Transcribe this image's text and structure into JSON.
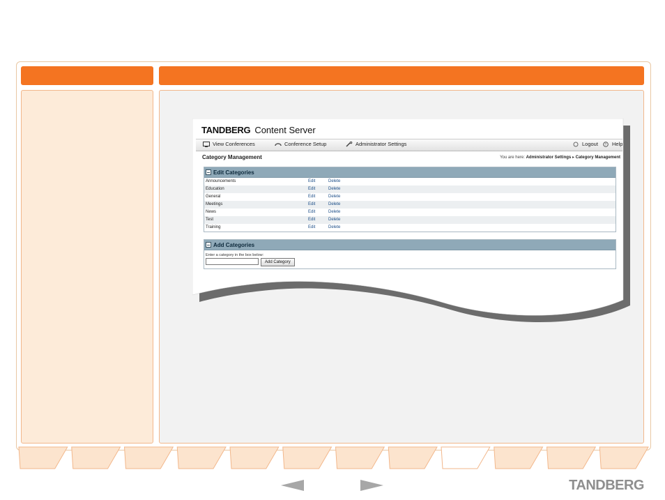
{
  "app": {
    "brand_strong": "TANDBERG",
    "brand_light": "Content Server"
  },
  "nav": {
    "items": [
      {
        "label": "View Conferences",
        "icon": "monitor-icon"
      },
      {
        "label": "Conference Setup",
        "icon": "phone-icon"
      },
      {
        "label": "Administrator Settings",
        "icon": "wrench-icon"
      }
    ],
    "logout": "Logout",
    "help": "Help"
  },
  "page": {
    "title": "Category Management",
    "breadcrumb_prefix": "You are here:",
    "breadcrumb_parent": "Administrator Settings",
    "breadcrumb_sep": "▸",
    "breadcrumb_current": "Category Management"
  },
  "edit_categories": {
    "heading": "Edit Categories",
    "edit_label": "Edit",
    "delete_label": "Delete",
    "rows": [
      "Announcements",
      "Education",
      "General",
      "Meetings",
      "News",
      "Test",
      "Training"
    ]
  },
  "add_categories": {
    "heading": "Add Categories",
    "hint": "Enter a category in the box below:",
    "input_value": "",
    "button_label": "Add Category"
  },
  "footer": {
    "logo": "TANDBERG",
    "prev_icon": "arrow-left-icon",
    "next_icon": "arrow-right-icon"
  },
  "colors": {
    "accent": "#f47421",
    "panel_tint": "#fdebd9",
    "box_header": "#8fa9b8",
    "link": "#1c4e88"
  }
}
